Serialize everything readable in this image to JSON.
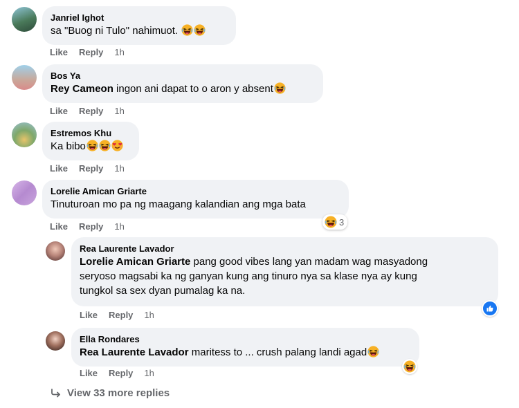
{
  "comments": [
    {
      "name": "Janriel Ighot",
      "text": "sa \"Buog ni Tulo\" nahimuot.",
      "like": "Like",
      "reply": "Reply",
      "time": "1h"
    },
    {
      "name": "Bos Ya",
      "mention": "Rey Cameon",
      "text": " ingon ani dapat to o aron y absent",
      "like": "Like",
      "reply": "Reply",
      "time": "1h"
    },
    {
      "name": "Estremos Khu",
      "text": "Ka bibo",
      "like": "Like",
      "reply": "Reply",
      "time": "1h"
    },
    {
      "name": "Lorelie Amican Griarte",
      "text": "Tinuturoan mo pa ng maagang kalandian ang mga bata",
      "like": "Like",
      "reply": "Reply",
      "time": "1h",
      "reaction_count": "3"
    }
  ],
  "replies": [
    {
      "name": "Rea Laurente Lavador",
      "mention": "Lorelie Amican Griarte",
      "line1": " pang good vibes lang yan madam wag masyadong",
      "line2": "seryoso magsabi ka ng ganyan kung ang tinuro nya sa klase nya ay kung",
      "line3": "tungkol sa sex dyan pumalag ka na.",
      "like": "Like",
      "reply": "Reply",
      "time": "1h"
    },
    {
      "name": "Ella Rondares",
      "mention": "Rea Laurente Lavador",
      "text": " maritess to ... crush palang landi agad",
      "like": "Like",
      "reply": "Reply",
      "time": "1h"
    }
  ],
  "view_more": "View 33 more replies",
  "icons": {
    "reply_arrow": "reply-arrow-icon",
    "laugh": "laugh-emoji-icon",
    "love": "love-emoji-icon",
    "like": "like-reaction-icon"
  },
  "colors": {
    "bubble": "#f0f2f5",
    "muted": "#65676b",
    "like_blue": "#1877f2",
    "emoji_yellow": "#f7b125"
  }
}
